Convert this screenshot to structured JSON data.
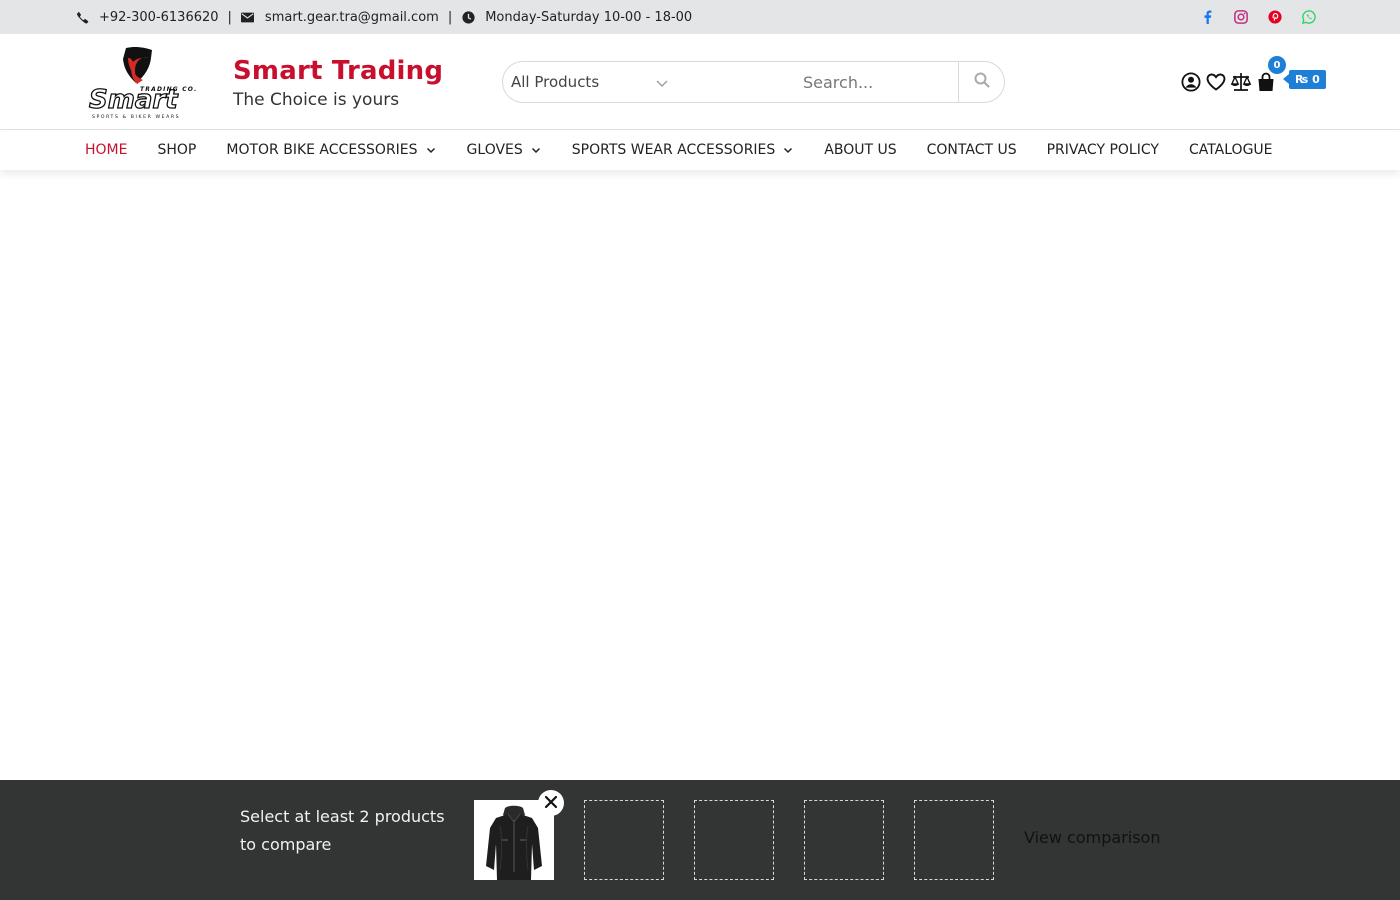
{
  "topbar": {
    "phone": "+92-300-6136620",
    "email": "smart.gear.tra@gmail.com",
    "hours": "Monday-Saturday 10-00 - 18-00",
    "separator": "|",
    "social": [
      "facebook-icon",
      "instagram-icon",
      "pinterest-icon",
      "whatsapp-icon"
    ],
    "social_colors": {
      "facebook": "#1877f2",
      "instagram": "#c13584",
      "pinterest": "#e60023",
      "whatsapp": "#25d366"
    }
  },
  "header": {
    "brand_name": "Smart Trading",
    "brand_tagline": "The Choice is yours",
    "brand_color": "#c8102e",
    "search": {
      "category_selected": "All Products",
      "placeholder": "Search..."
    },
    "cart": {
      "count": "0",
      "total": "₨ 0",
      "badge_color": "#1e7fd6"
    }
  },
  "nav": {
    "items": [
      {
        "label": "HOME",
        "active": true
      },
      {
        "label": "SHOP"
      },
      {
        "label": "MOTOR BIKE ACCESSORIES",
        "dropdown": true
      },
      {
        "label": "GLOVES",
        "dropdown": true
      },
      {
        "label": "SPORTS WEAR ACCESSORIES",
        "dropdown": true
      },
      {
        "label": "ABOUT US"
      },
      {
        "label": "CONTACT US"
      },
      {
        "label": "PRIVACY POLICY"
      },
      {
        "label": "CATALOGUE"
      }
    ]
  },
  "compare": {
    "message": "Select at least 2 products to compare",
    "view_label": "View comparison",
    "slots_total": 5,
    "slots_filled": 1
  }
}
